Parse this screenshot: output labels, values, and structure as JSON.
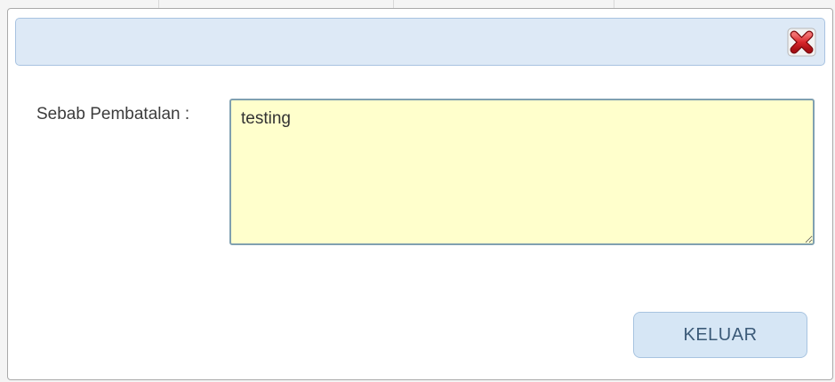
{
  "dialog": {
    "close_icon": "close-icon",
    "close_icon_color": "#d9262b"
  },
  "form": {
    "reason_label": "Sebab Pembatalan :",
    "reason_value": "testing"
  },
  "actions": {
    "exit_label": "KELUAR"
  },
  "colors": {
    "titlebar": "#dde9f6",
    "textarea_background": "#ffffcc",
    "button_background": "#d6e6f5"
  }
}
